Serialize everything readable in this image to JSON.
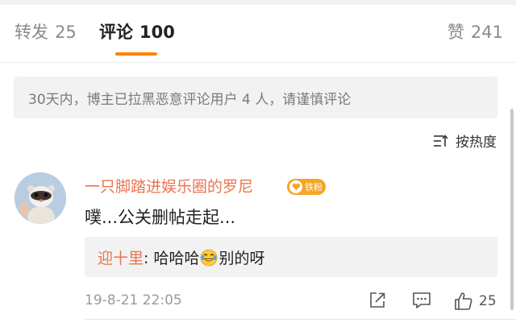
{
  "tabs": {
    "repost": {
      "label": "转发",
      "count": "25"
    },
    "comment": {
      "label": "评论",
      "count": "100"
    },
    "like": {
      "label": "赞",
      "count": "241"
    }
  },
  "notice": {
    "text": "30天内，博主已拉黑恶意评论用户 4 人，请谨慎评论"
  },
  "sort": {
    "label": "按热度"
  },
  "comment": {
    "username": "一只脚踏进娱乐圈的罗尼",
    "badge": "铁粉",
    "text": "噗...公关删帖走起...",
    "reply": {
      "user": "迎十里",
      "separator": ": ",
      "text_before": "哈哈哈",
      "emoji": "laughing-crying-emoji",
      "text_after": "别的呀"
    },
    "timestamp": "19-8-21 22:05",
    "likes": "25"
  },
  "colors": {
    "accent": "#ff8200",
    "username": "#eb7350",
    "badge": "#f5a623"
  }
}
